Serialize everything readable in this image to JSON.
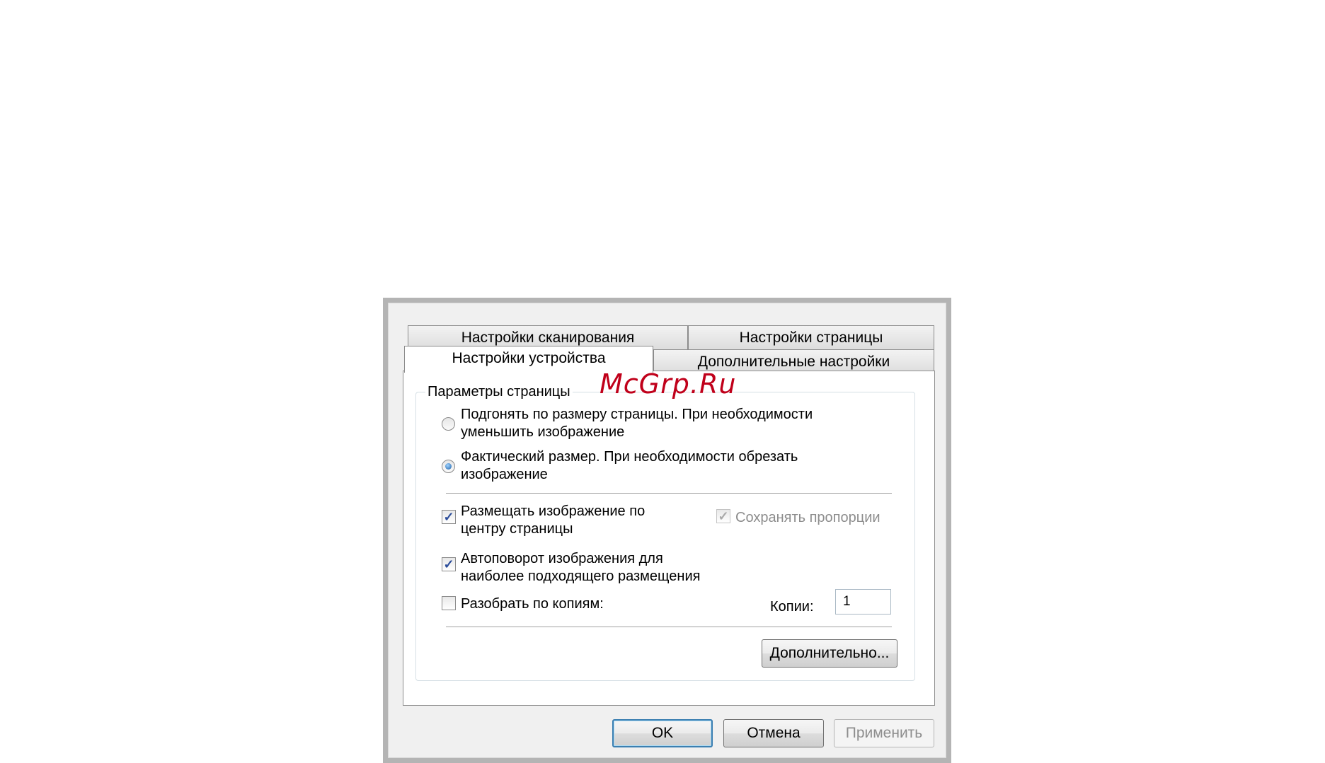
{
  "watermark": "McGrp.Ru",
  "tabs": {
    "row_back": [
      {
        "label": "Настройки сканирования"
      },
      {
        "label": "Настройки страницы"
      }
    ],
    "row_front": [
      {
        "label": "Настройки устройства",
        "active": true
      },
      {
        "label": "Дополнительные настройки"
      }
    ]
  },
  "page_params": {
    "title": "Параметры страницы",
    "options": [
      {
        "line1": "Подгонять по размеру страницы. При необходимости",
        "line2": "уменьшить изображение",
        "selected": false
      },
      {
        "line1": "Фактический размер. При необходимости обрезать",
        "line2": "изображение",
        "selected": true
      }
    ],
    "center_image": {
      "line1": "Размещать изображение по",
      "line2": "центру страницы",
      "checked": true
    },
    "keep_proportions": {
      "label": "Сохранять пропорции",
      "checked": true,
      "enabled": false
    },
    "autorotate": {
      "line1": "Автоповорот изображения для",
      "line2": "наиболее подходящего размещения",
      "checked": true
    },
    "collate": {
      "label": "Разобрать по копиям:",
      "checked": false
    },
    "copies": {
      "label": "Копии:",
      "value": "1"
    },
    "advanced_button": "Дополнительно..."
  },
  "buttons": {
    "ok": "OK",
    "cancel": "Отмена",
    "apply": "Применить"
  },
  "colors": {
    "check_mark": "#2b4c9a",
    "default_button_border": "#3c7fb1",
    "watermark": "#c0001a"
  }
}
